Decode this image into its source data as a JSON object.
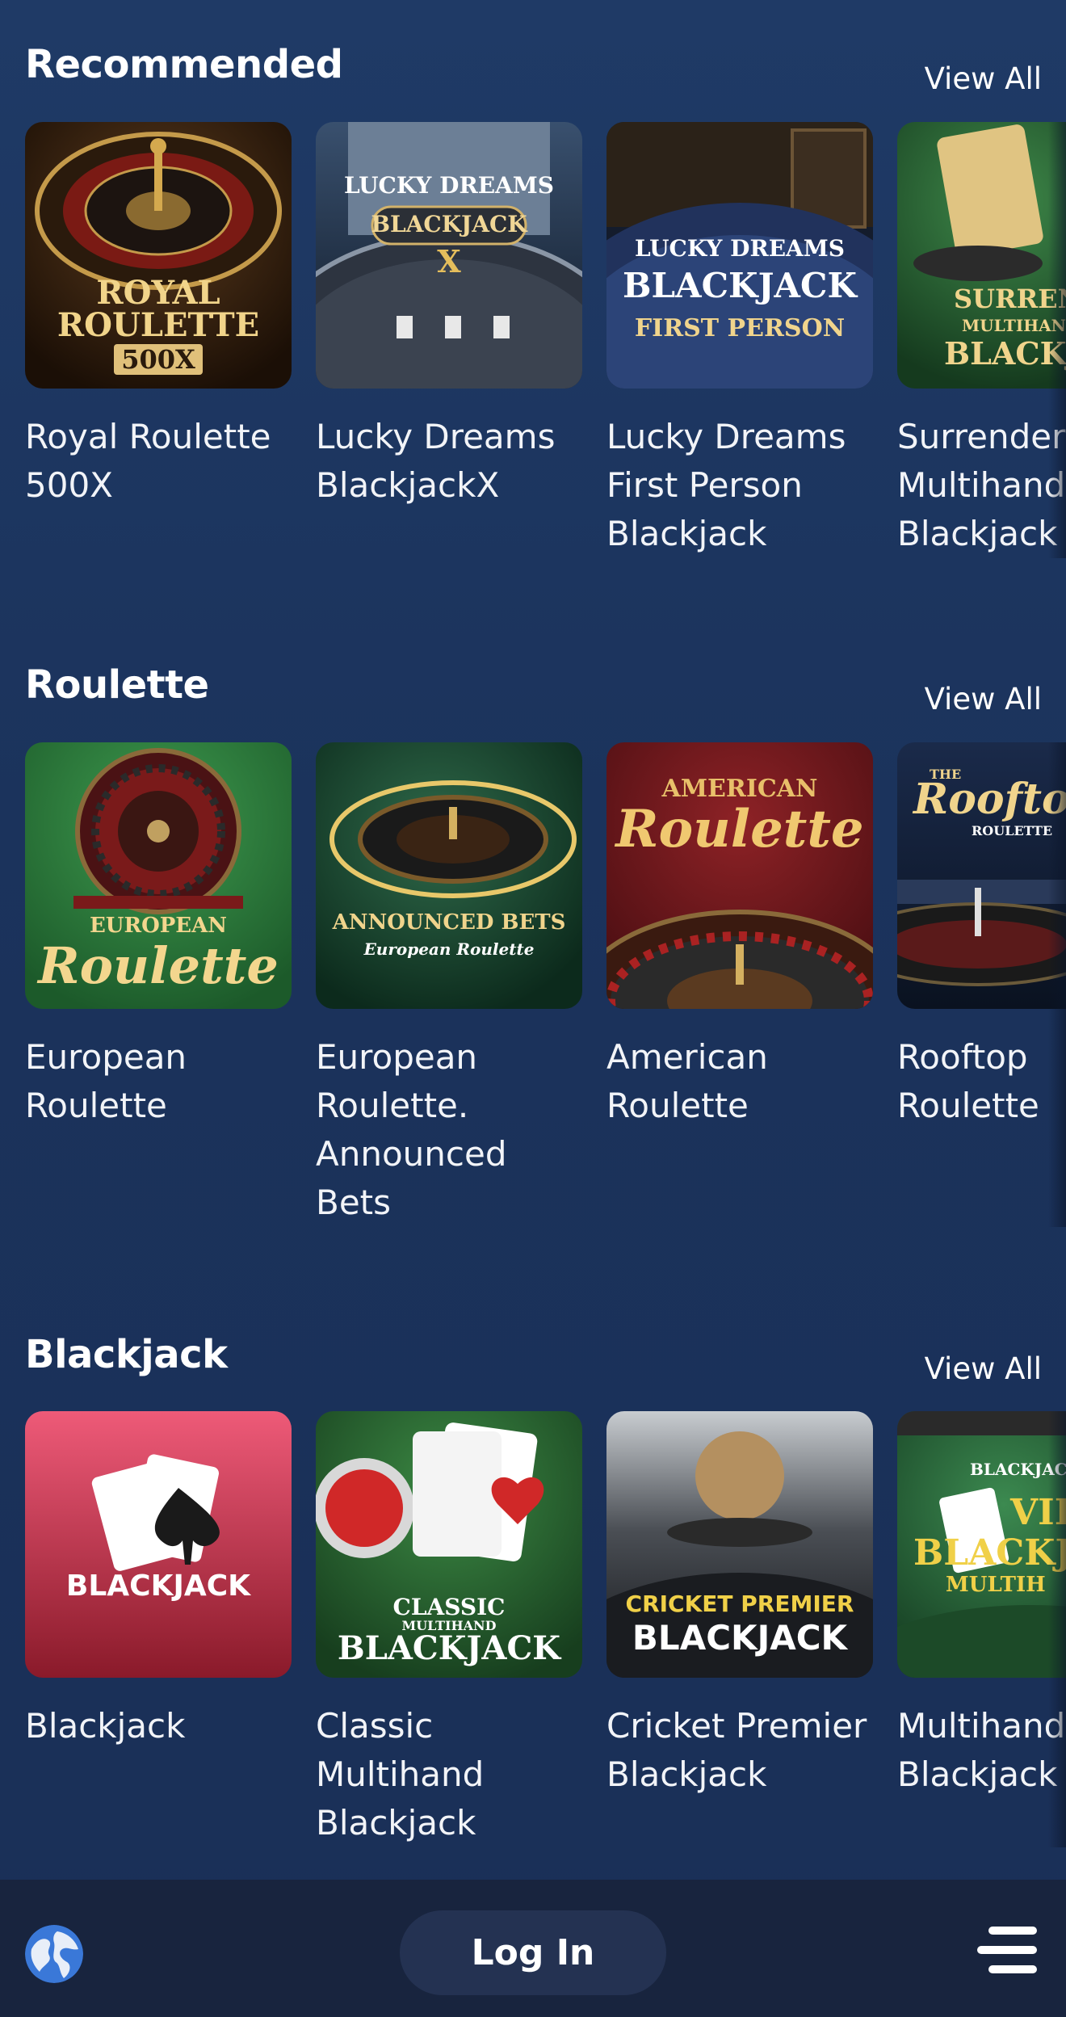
{
  "sections": [
    {
      "title": "Recommended",
      "view_all": "View All",
      "games": [
        {
          "name": "Royal Roulette 500X",
          "art_lines": [
            "ROYAL",
            "ROULETTE",
            "500X"
          ]
        },
        {
          "name": "Lucky Dreams BlackjackX",
          "art_lines": [
            "LUCKY DREAMS",
            "BLACKJACK",
            "X"
          ]
        },
        {
          "name": "Lucky Dreams First Person Blackjack",
          "art_lines": [
            "LUCKY DREAMS",
            "BLACKJACK",
            "FIRST PERSON"
          ]
        },
        {
          "name": "Surrender Multihand Blackjack",
          "art_lines": [
            "SURREND",
            "MULTIHAN",
            "BLACKJ"
          ]
        }
      ]
    },
    {
      "title": "Roulette",
      "view_all": "View All",
      "games": [
        {
          "name": "European Roulette",
          "art_lines": [
            "EUROPEAN",
            "Roulette"
          ]
        },
        {
          "name": "European Roulette. Announced Bets",
          "art_lines": [
            "ANNOUNCED BETS",
            "European Roulette"
          ]
        },
        {
          "name": "American Roulette",
          "art_lines": [
            "AMERICAN",
            "Roulette"
          ]
        },
        {
          "name": "Rooftop Roulette",
          "art_lines": [
            "THE",
            "Roofto",
            "ROULETTE"
          ]
        }
      ]
    },
    {
      "title": "Blackjack",
      "view_all": "View All",
      "games": [
        {
          "name": "Blackjack",
          "art_lines": [
            "BLACKJACK"
          ]
        },
        {
          "name": "Classic Multihand Blackjack",
          "art_lines": [
            "CLASSIC",
            "MULTIHAND",
            "BLACKJACK"
          ]
        },
        {
          "name": "Cricket Premier Blackjack",
          "art_lines": [
            "CRICKET PREMIER",
            "BLACKJACK"
          ]
        },
        {
          "name": "Multihand Blackjack VIP",
          "art_lines": [
            "BLACKJAC",
            "VIP",
            "BLACKJ",
            "MULTIH"
          ]
        }
      ]
    }
  ],
  "bottom_bar": {
    "login_label": "Log In",
    "globe_icon": "globe-icon",
    "menu_icon": "hamburger-menu-icon"
  },
  "colors": {
    "background": "#1f3a66",
    "bottom_bar": "#18243e",
    "login_button": "#243252"
  }
}
